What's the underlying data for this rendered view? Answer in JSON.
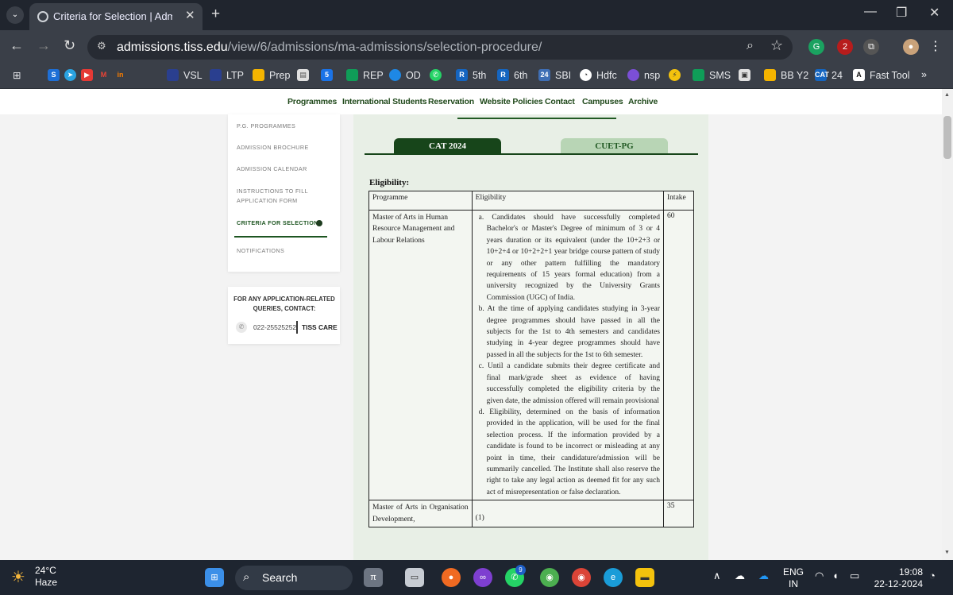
{
  "browser": {
    "tab_title": "Criteria for Selection | Admissio",
    "url_domain": "admissions.tiss.edu",
    "url_path": "/view/6/admissions/ma-admissions/selection-procedure/",
    "window_controls": {
      "minimize": "—",
      "restore": "❐",
      "close": "✕"
    }
  },
  "bookmarks": [
    {
      "label": "VSL",
      "color": "#2a3f8f"
    },
    {
      "label": "LTP",
      "color": "#2a3f8f"
    },
    {
      "label": "Prep",
      "color": "#f4b400"
    },
    {
      "label": "REP",
      "color": "#0f9d58"
    },
    {
      "label": "OD",
      "color": "#1e88e5"
    },
    {
      "label": "5th",
      "color": "#1565c0"
    },
    {
      "label": "6th",
      "color": "#1565c0"
    },
    {
      "label": "SBI",
      "color": "#3f6fb5"
    },
    {
      "label": "Hdfc",
      "color": "#ffffff"
    },
    {
      "label": "nsp",
      "color": "#7b4fd6"
    },
    {
      "label": "SMS",
      "color": "#0f9d58"
    },
    {
      "label": "BB Y2",
      "color": "#f4b400"
    },
    {
      "label": "24",
      "color": "#1565c0"
    },
    {
      "label": "Fast Tool",
      "color": "#ffffff"
    }
  ],
  "topnav": [
    "Programmes",
    "International Students",
    "Reservation",
    "Website Policies",
    "Contact",
    "Campuses",
    "Archive"
  ],
  "sidebar": {
    "items": [
      "P.G. PROGRAMMES",
      "ADMISSION BROCHURE",
      "ADMISSION CALENDAR",
      "INSTRUCTIONS TO FILL APPLICATION FORM",
      "CRITERIA FOR SELECTION",
      "NOTIFICATIONS"
    ],
    "active_index": 4
  },
  "contact": {
    "title": "FOR ANY APPLICATION-RELATED QUERIES, CONTACT:",
    "phone": "022-25525252",
    "care": "TISS CARE"
  },
  "content": {
    "tabs": [
      "CAT 2024",
      "CUET-PG"
    ],
    "active_tab": 0,
    "section_title": "Eligibility:",
    "table": {
      "headers": [
        "Programme",
        "Eligibility",
        "Intake"
      ],
      "row1": {
        "programme": "Master of Arts in Human Resource Management and Labour Relations",
        "criteria": [
          "a. Candidates should have successfully completed Bachelor's or Master's Degree of minimum of 3 or 4 years duration or its equivalent (under the 10+2+3 or 10+2+4 or 10+2+2+1 year bridge course pattern of study or any other pattern fulfilling the mandatory requirements of 15 years formal education) from a university recognized by the University Grants Commission (UGC) of India.",
          "b. At the time of applying candidates studying in 3-year degree programmes should have passed in all the subjects for the 1st to 4th semesters and candidates studying in 4-year degree programmes should have passed in all the subjects for the 1st to 6th semester.",
          "c. Until a candidate submits their degree certificate and final mark/grade sheet as evidence of having successfully completed the eligibility criteria by the given date, the admission offered will remain provisional",
          "d. Eligibility, determined on the basis of information provided in the application, will be used for the final selection process. If the information provided by a candidate is found to be incorrect or misleading at any point in time, their candidature/admission will be summarily cancelled. The Institute shall also reserve the right to take any legal action as deemed fit for any such act of misrepresentation or false declaration."
        ],
        "intake": "60"
      },
      "row2": {
        "programme": "Master of Arts in Organisation Development,",
        "criteria": "(1)",
        "intake": "35"
      }
    }
  },
  "taskbar": {
    "temperature": "24°C",
    "weather": "Haze",
    "search_placeholder": "Search",
    "whatsapp_badge": "9",
    "language": "ENG",
    "region": "IN",
    "time": "19:08",
    "date": "22-12-2024"
  },
  "colors": {
    "accent_green": "#17451a",
    "light_green_tab": "#b8d5b5",
    "content_bg": "#e8efe6",
    "chrome_dark": "#20252e"
  }
}
